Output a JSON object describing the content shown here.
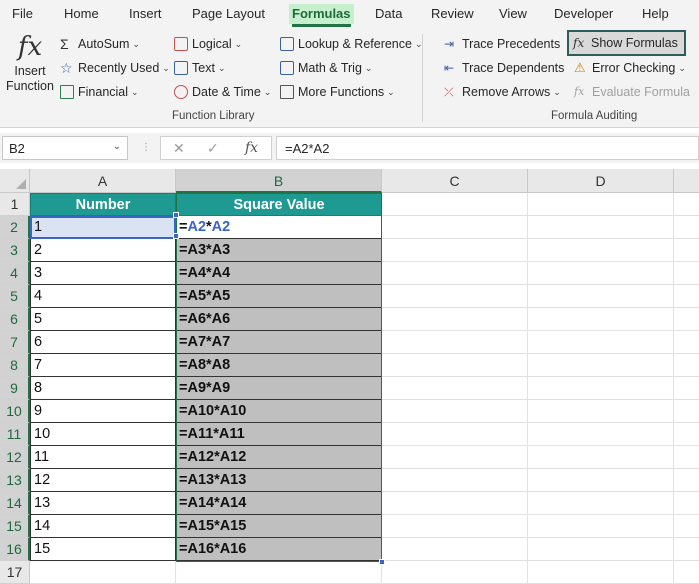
{
  "ribbon_tabs": [
    "File",
    "Home",
    "Insert",
    "Page Layout",
    "Formulas",
    "Data",
    "Review",
    "View",
    "Developer",
    "Help"
  ],
  "active_tab": "Formulas",
  "function_library": {
    "insert_function": [
      "Insert",
      "Function"
    ],
    "autosum": "AutoSum",
    "recently_used": "Recently Used",
    "financial": "Financial",
    "logical": "Logical",
    "text": "Text",
    "date_time": "Date & Time",
    "lookup": "Lookup & Reference",
    "math_trig": "Math & Trig",
    "more_functions": "More Functions",
    "label": "Function Library"
  },
  "formula_auditing": {
    "trace_precedents": "Trace Precedents",
    "trace_dependents": "Trace Dependents",
    "remove_arrows": "Remove Arrows",
    "show_formulas": "Show Formulas",
    "error_checking": "Error Checking",
    "evaluate_formula": "Evaluate Formula",
    "label": "Formula Auditing"
  },
  "formula_bar": {
    "name_box": "B2",
    "formula": "=A2*A2"
  },
  "columns": [
    "A",
    "B",
    "C",
    "D"
  ],
  "rows": [
    "1",
    "2",
    "3",
    "4",
    "5",
    "6",
    "7",
    "8",
    "9",
    "10",
    "11",
    "12",
    "13",
    "14",
    "15",
    "16",
    "17"
  ],
  "table": {
    "headers": [
      "Number",
      "Square Value"
    ],
    "active_formula_parts": [
      "=",
      "A2",
      "*",
      "A2"
    ],
    "numbers": [
      "1",
      "2",
      "3",
      "4",
      "5",
      "6",
      "7",
      "8",
      "9",
      "10",
      "11",
      "12",
      "13",
      "14",
      "15"
    ],
    "formulas": [
      "=A2*A2",
      "=A3*A3",
      "=A4*A4",
      "=A5*A5",
      "=A6*A6",
      "=A7*A7",
      "=A8*A8",
      "=A9*A9",
      "=A10*A10",
      "=A11*A11",
      "=A12*A12",
      "=A13*A13",
      "=A14*A14",
      "=A15*A15",
      "=A16*A16"
    ]
  },
  "colors": {
    "header_fill": "#1f9a92",
    "formula_fill": "#bfbfbf",
    "excel_green": "#217346",
    "reference_blue": "#3a64c8"
  }
}
